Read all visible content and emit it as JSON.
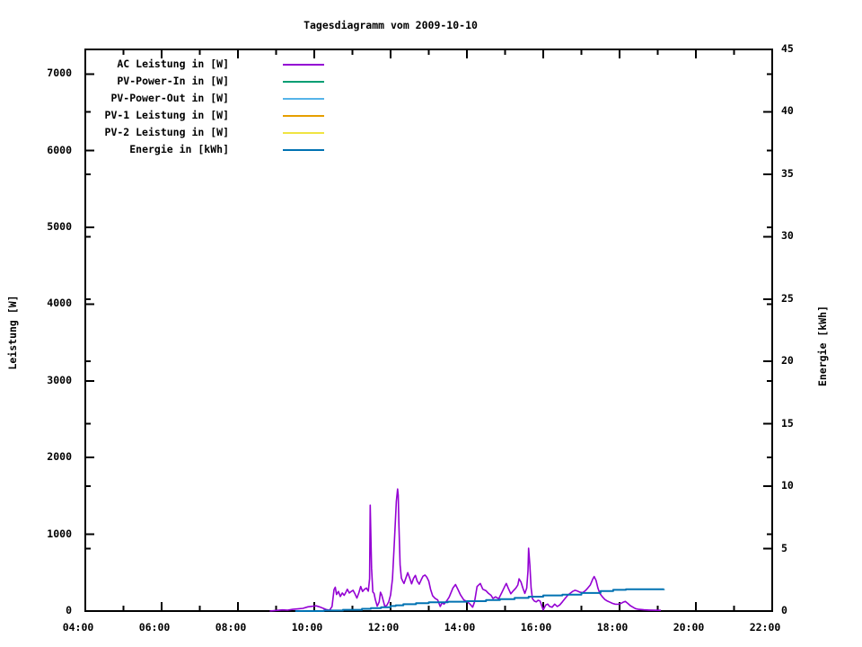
{
  "title": "Tagesdiagramm vom 2009-10-10",
  "axes": {
    "left_label": "Leistung [W]",
    "right_label": "Energie [kWh]"
  },
  "legend": {
    "items": [
      {
        "label": "AC Leistung in [W]",
        "color": "#9400d3"
      },
      {
        "label": "PV-Power-In in [W]",
        "color": "#009e73"
      },
      {
        "label": "PV-Power-Out in [W]",
        "color": "#56b4e9"
      },
      {
        "label": "PV-1 Leistung in [W]",
        "color": "#e69f00"
      },
      {
        "label": "PV-2 Leistung in [W]",
        "color": "#f0e442"
      },
      {
        "label": "Energie in [kWh]",
        "color": "#0072b2"
      }
    ]
  },
  "chart_data": {
    "type": "line",
    "title": "Tagesdiagramm vom 2009-10-10",
    "xlabel": "",
    "ylabel": "Leistung [W]",
    "y2label": "Energie [kWh]",
    "x_range": [
      "04:00",
      "22:00"
    ],
    "x_major_tick_hours": 2,
    "x_minor_tick_hours": 1,
    "x_tick_labels": [
      "04:00",
      "06:00",
      "08:00",
      "10:00",
      "12:00",
      "14:00",
      "16:00",
      "18:00",
      "20:00",
      "22:00"
    ],
    "ylim": [
      0,
      7320
    ],
    "y_ticks": [
      0,
      1000,
      2000,
      3000,
      4000,
      5000,
      6000,
      7000
    ],
    "y2lim": [
      0,
      45
    ],
    "y2_ticks": [
      0,
      5,
      10,
      15,
      20,
      25,
      30,
      35,
      40,
      45
    ],
    "grid": false,
    "legend_position": "top-left",
    "axis_color": "#000000",
    "background_color": "#ffffff",
    "series": [
      {
        "name": "AC Leistung in [W]",
        "color": "#9400d3",
        "axis": "y1",
        "style": "lines",
        "points": [
          [
            "08:50",
            0
          ],
          [
            "09:00",
            8
          ],
          [
            "09:10",
            15
          ],
          [
            "09:18",
            12
          ],
          [
            "09:26",
            22
          ],
          [
            "09:34",
            28
          ],
          [
            "09:42",
            35
          ],
          [
            "09:50",
            55
          ],
          [
            "09:57",
            62
          ],
          [
            "10:03",
            68
          ],
          [
            "10:08",
            55
          ],
          [
            "10:13",
            40
          ],
          [
            "10:18",
            22
          ],
          [
            "10:24",
            10
          ],
          [
            "10:28",
            60
          ],
          [
            "10:31",
            280
          ],
          [
            "10:33",
            310
          ],
          [
            "10:35",
            215
          ],
          [
            "10:38",
            255
          ],
          [
            "10:41",
            190
          ],
          [
            "10:44",
            235
          ],
          [
            "10:47",
            205
          ],
          [
            "10:50",
            250
          ],
          [
            "10:52",
            285
          ],
          [
            "10:55",
            235
          ],
          [
            "10:58",
            255
          ],
          [
            "11:01",
            270
          ],
          [
            "11:04",
            225
          ],
          [
            "11:07",
            170
          ],
          [
            "11:10",
            235
          ],
          [
            "11:13",
            320
          ],
          [
            "11:16",
            255
          ],
          [
            "11:19",
            285
          ],
          [
            "11:22",
            300
          ],
          [
            "11:25",
            260
          ],
          [
            "11:27",
            420
          ],
          [
            "11:28",
            1380
          ],
          [
            "11:30",
            560
          ],
          [
            "11:32",
            250
          ],
          [
            "11:34",
            230
          ],
          [
            "11:36",
            150
          ],
          [
            "11:39",
            65
          ],
          [
            "11:42",
            120
          ],
          [
            "11:44",
            245
          ],
          [
            "11:46",
            210
          ],
          [
            "11:48",
            150
          ],
          [
            "11:51",
            60
          ],
          [
            "11:54",
            75
          ],
          [
            "11:57",
            120
          ],
          [
            "12:00",
            210
          ],
          [
            "12:03",
            420
          ],
          [
            "12:06",
            900
          ],
          [
            "12:09",
            1430
          ],
          [
            "12:11",
            1590
          ],
          [
            "12:12",
            1510
          ],
          [
            "12:13",
            1150
          ],
          [
            "12:15",
            600
          ],
          [
            "12:17",
            430
          ],
          [
            "12:19",
            390
          ],
          [
            "12:21",
            360
          ],
          [
            "12:24",
            430
          ],
          [
            "12:27",
            500
          ],
          [
            "12:30",
            430
          ],
          [
            "12:33",
            355
          ],
          [
            "12:36",
            425
          ],
          [
            "12:39",
            465
          ],
          [
            "12:42",
            390
          ],
          [
            "12:45",
            350
          ],
          [
            "12:48",
            405
          ],
          [
            "12:51",
            455
          ],
          [
            "12:54",
            470
          ],
          [
            "12:57",
            440
          ],
          [
            "13:00",
            390
          ],
          [
            "13:03",
            280
          ],
          [
            "13:06",
            200
          ],
          [
            "13:10",
            165
          ],
          [
            "13:14",
            145
          ],
          [
            "13:18",
            60
          ],
          [
            "13:21",
            110
          ],
          [
            "13:24",
            90
          ],
          [
            "13:28",
            130
          ],
          [
            "13:32",
            180
          ],
          [
            "13:38",
            300
          ],
          [
            "13:42",
            345
          ],
          [
            "13:46",
            280
          ],
          [
            "13:50",
            210
          ],
          [
            "13:55",
            145
          ],
          [
            "14:00",
            125
          ],
          [
            "14:05",
            90
          ],
          [
            "14:09",
            50
          ],
          [
            "14:12",
            120
          ],
          [
            "14:16",
            320
          ],
          [
            "14:21",
            360
          ],
          [
            "14:25",
            285
          ],
          [
            "14:30",
            265
          ],
          [
            "14:34",
            230
          ],
          [
            "14:38",
            205
          ],
          [
            "14:41",
            165
          ],
          [
            "14:45",
            185
          ],
          [
            "14:50",
            160
          ],
          [
            "14:55",
            245
          ],
          [
            "15:00",
            330
          ],
          [
            "15:02",
            360
          ],
          [
            "15:05",
            300
          ],
          [
            "15:09",
            225
          ],
          [
            "15:13",
            265
          ],
          [
            "15:17",
            300
          ],
          [
            "15:20",
            340
          ],
          [
            "15:22",
            420
          ],
          [
            "15:25",
            380
          ],
          [
            "15:28",
            300
          ],
          [
            "15:31",
            230
          ],
          [
            "15:34",
            300
          ],
          [
            "15:36",
            520
          ],
          [
            "15:37",
            820
          ],
          [
            "15:39",
            600
          ],
          [
            "15:41",
            300
          ],
          [
            "15:43",
            160
          ],
          [
            "15:46",
            130
          ],
          [
            "15:49",
            120
          ],
          [
            "15:52",
            140
          ],
          [
            "15:55",
            130
          ],
          [
            "15:58",
            60
          ],
          [
            "16:00",
            15
          ],
          [
            "16:04",
            80
          ],
          [
            "16:07",
            90
          ],
          [
            "16:10",
            60
          ],
          [
            "16:14",
            50
          ],
          [
            "16:18",
            90
          ],
          [
            "16:22",
            60
          ],
          [
            "16:26",
            80
          ],
          [
            "16:30",
            120
          ],
          [
            "16:34",
            160
          ],
          [
            "16:38",
            200
          ],
          [
            "16:42",
            230
          ],
          [
            "16:46",
            255
          ],
          [
            "16:50",
            270
          ],
          [
            "16:54",
            260
          ],
          [
            "16:58",
            245
          ],
          [
            "17:02",
            240
          ],
          [
            "17:06",
            265
          ],
          [
            "17:10",
            300
          ],
          [
            "17:14",
            340
          ],
          [
            "17:18",
            420
          ],
          [
            "17:20",
            450
          ],
          [
            "17:23",
            400
          ],
          [
            "17:26",
            300
          ],
          [
            "17:29",
            230
          ],
          [
            "17:33",
            185
          ],
          [
            "17:37",
            150
          ],
          [
            "17:41",
            130
          ],
          [
            "17:45",
            115
          ],
          [
            "17:49",
            100
          ],
          [
            "17:53",
            90
          ],
          [
            "17:57",
            88
          ],
          [
            "18:01",
            95
          ],
          [
            "18:05",
            112
          ],
          [
            "18:09",
            125
          ],
          [
            "18:13",
            100
          ],
          [
            "18:17",
            70
          ],
          [
            "18:21",
            50
          ],
          [
            "18:25",
            32
          ],
          [
            "18:30",
            22
          ],
          [
            "18:38",
            16
          ],
          [
            "18:46",
            13
          ],
          [
            "18:55",
            11
          ],
          [
            "19:05",
            9
          ]
        ]
      },
      {
        "name": "PV-Power-In in [W]",
        "color": "#009e73",
        "axis": "y1",
        "style": "lines",
        "points": []
      },
      {
        "name": "PV-Power-Out in [W]",
        "color": "#56b4e9",
        "axis": "y1",
        "style": "lines",
        "points": []
      },
      {
        "name": "PV-1 Leistung in [W]",
        "color": "#e69f00",
        "axis": "y1",
        "style": "lines",
        "points": []
      },
      {
        "name": "PV-2 Leistung in [W]",
        "color": "#f0e442",
        "axis": "y1",
        "style": "lines",
        "points": []
      },
      {
        "name": "Energie in [kWh]",
        "color": "#0072b2",
        "axis": "y2",
        "style": "steps",
        "points": [
          [
            "09:30",
            0.0
          ],
          [
            "10:15",
            0.04
          ],
          [
            "10:45",
            0.1
          ],
          [
            "11:15",
            0.18
          ],
          [
            "11:29",
            0.24
          ],
          [
            "11:45",
            0.3
          ],
          [
            "12:00",
            0.4
          ],
          [
            "12:08",
            0.46
          ],
          [
            "12:20",
            0.55
          ],
          [
            "12:40",
            0.63
          ],
          [
            "13:00",
            0.7
          ],
          [
            "13:30",
            0.75
          ],
          [
            "14:00",
            0.79
          ],
          [
            "14:30",
            0.88
          ],
          [
            "14:52",
            0.96
          ],
          [
            "15:15",
            1.05
          ],
          [
            "15:37",
            1.15
          ],
          [
            "16:00",
            1.25
          ],
          [
            "16:30",
            1.32
          ],
          [
            "17:00",
            1.45
          ],
          [
            "17:30",
            1.6
          ],
          [
            "17:50",
            1.7
          ],
          [
            "18:10",
            1.74
          ],
          [
            "19:10",
            1.75
          ]
        ]
      }
    ]
  }
}
